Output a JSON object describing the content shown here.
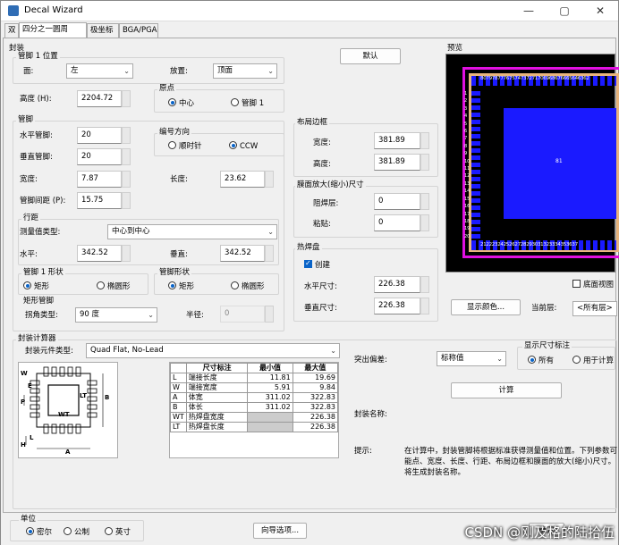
{
  "window": {
    "title": "Decal Wizard",
    "min": "—",
    "max": "▢",
    "close": "✕"
  },
  "tabs": [
    "双",
    "四分之一圆周",
    "极坐标",
    "BGA/PGA"
  ],
  "package_group": "封装",
  "pin1": {
    "title": "管脚 1 位置",
    "side_label": "面:",
    "side_value": "左",
    "place_label": "放置:",
    "place_value": "顶面"
  },
  "default_button": "默认",
  "height": {
    "label": "高度 (H):",
    "value": "2204.72"
  },
  "origin": {
    "title": "原点",
    "center": "中心",
    "pin1": "管脚 1"
  },
  "pins": {
    "title": "管脚",
    "horiz_label": "水平管脚:",
    "horiz_value": "20",
    "vert_label": "垂直管脚:",
    "vert_value": "20",
    "width_label": "宽度:",
    "width_value": "7.87",
    "length_label": "长度:",
    "length_value": "23.62",
    "pitch_label": "管脚间距 (P):",
    "pitch_value": "15.75"
  },
  "numbering": {
    "title": "编号方向",
    "cw": "顺时针",
    "ccw": "CCW"
  },
  "placement_border": {
    "title": "布局边框",
    "width_label": "宽度:",
    "width_value": "381.89",
    "height_label": "高度:",
    "height_value": "381.89"
  },
  "mask": {
    "title": "膜面放大(缩小)尺寸",
    "solder_label": "阻焊层:",
    "solder_value": "0",
    "paste_label": "粘贴:",
    "paste_value": "0"
  },
  "row_spacing": {
    "title": "行距",
    "type_label": "测量值类型:",
    "type_value": "中心到中心",
    "h_label": "水平:",
    "h_value": "342.52",
    "v_label": "垂直:",
    "v_value": "342.52"
  },
  "pin1_shape": {
    "title": "管脚 1 形状",
    "rect": "矩形",
    "oval": "椭圆形"
  },
  "pin_shape": {
    "title": "管脚形状",
    "rect": "矩形",
    "oval": "椭圆形"
  },
  "corner": {
    "title": "矩形管脚",
    "type_label": "拐角类型:",
    "type_value": "90 度",
    "radius_label": "半径:",
    "radius_value": "0"
  },
  "thermal": {
    "title": "热焊盘",
    "create": "创建",
    "h_label": "水平尺寸:",
    "h_value": "226.38",
    "v_label": "垂直尺寸:",
    "v_value": "226.38"
  },
  "preview": {
    "title": "预览",
    "center_label": "81",
    "top_pins": "80797877767574737271706968676665646362",
    "bottom_pins": "2122232425262728293031323334353637",
    "left_pins": [
      "1",
      "2",
      "3",
      "4",
      "5",
      "6",
      "7",
      "8",
      "9",
      "10",
      "11",
      "12",
      "13",
      "14",
      "15",
      "16",
      "17",
      "18",
      "19",
      "20"
    ]
  },
  "bottom_view": "底面视图",
  "display_color": "显示颜色...",
  "current_layer": {
    "label": "当前层:",
    "value": "<所有层>"
  },
  "calculator": {
    "title": "封装计算器",
    "type_label": "封装元件类型:",
    "type_value": "Quad Flat, No-Lead",
    "highlight_label": "突出偏差:",
    "highlight_value": "标称值",
    "dim_title": "显示尺寸标注",
    "all": "所有",
    "for_calc": "用于计算",
    "calc_button": "计算",
    "name_label": "封装名称:",
    "tip_label": "提示:",
    "tip_text": "在计算中，封装管脚将根据标准获得测量值和位置。下列参数可能点、宽度、长度、行距、布局边框和膜面的放大(缩小)尺寸。将生成封装名称。",
    "diagram_labels": {
      "w": "W",
      "e": "E",
      "lt": "LT",
      "b": "B",
      "p": "P",
      "wt": "WT",
      "l": "L",
      "h": "H",
      "a": "A"
    }
  },
  "spec_table": {
    "headers": [
      "尺寸标注",
      "最小值",
      "最大值"
    ],
    "rows": [
      {
        "code": "L",
        "name": "端接长度",
        "min": "11.81",
        "max": "19.69"
      },
      {
        "code": "W",
        "name": "端接宽度",
        "min": "5.91",
        "max": "9.84"
      },
      {
        "code": "A",
        "name": "体宽",
        "min": "311.02",
        "max": "322.83"
      },
      {
        "code": "B",
        "name": "体长",
        "min": "311.02",
        "max": "322.83"
      },
      {
        "code": "WT",
        "name": "热焊盘宽度",
        "min": "",
        "max": "226.38"
      },
      {
        "code": "LT",
        "name": "热焊盘长度",
        "min": "",
        "max": "226.38"
      }
    ]
  },
  "units": {
    "title": "单位",
    "mil": "密尔",
    "metric": "公制",
    "inch": "英寸"
  },
  "wizard_options": "向导选项...",
  "ok": "确定",
  "watermark": "CSDN @刚及格的陆拾伍"
}
